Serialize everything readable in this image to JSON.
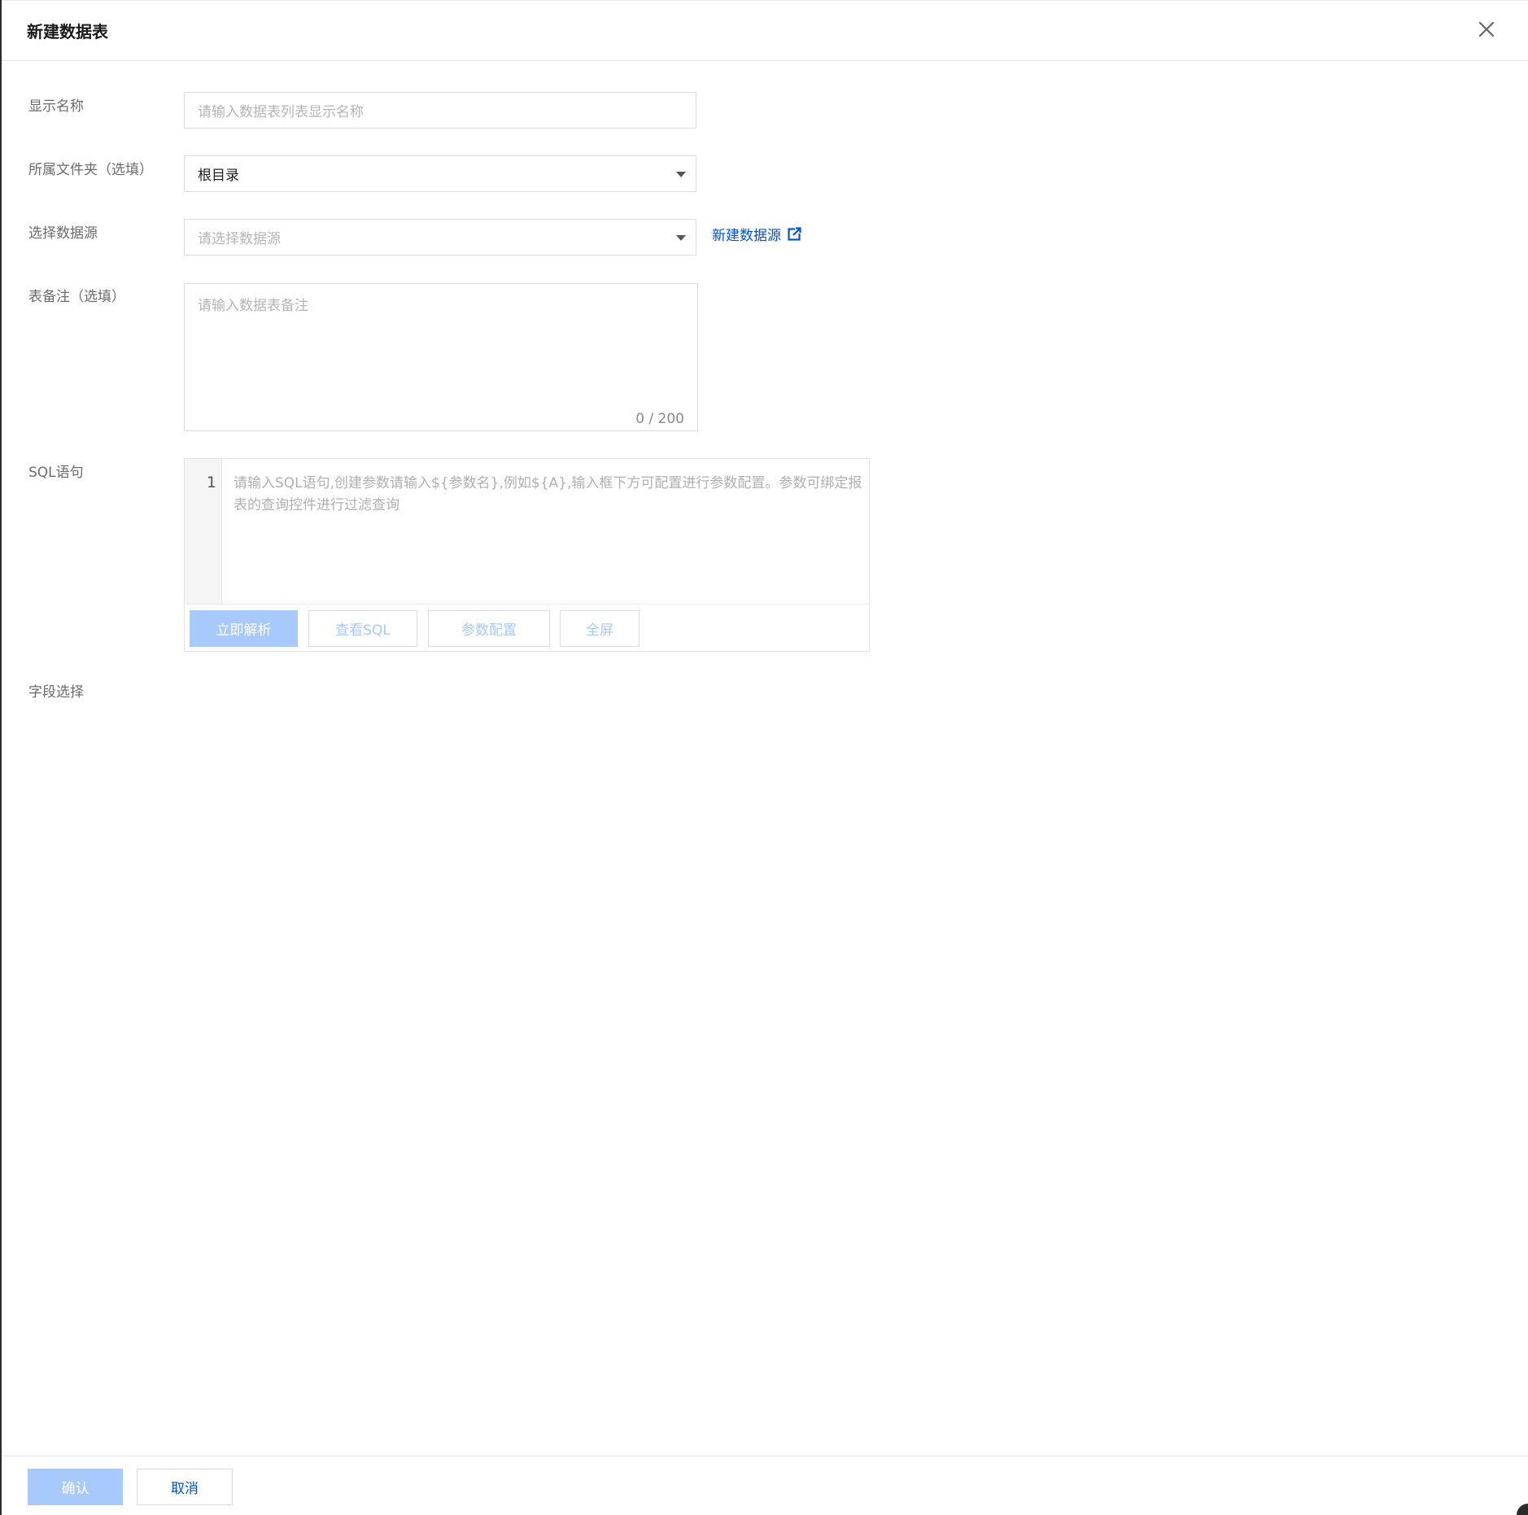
{
  "dialog": {
    "title": "新建数据表",
    "close_icon": "close-icon"
  },
  "form": {
    "display_name": {
      "label": "显示名称",
      "placeholder": "请输入数据表列表显示名称",
      "value": ""
    },
    "folder": {
      "label": "所属文件夹（选填）",
      "value": "根目录"
    },
    "datasource": {
      "label": "选择数据源",
      "placeholder": "请选择数据源",
      "new_link": "新建数据源",
      "link_icon": "external-link-icon"
    },
    "remark": {
      "label": "表备注（选填）",
      "placeholder": "请输入数据表备注",
      "counter": "0 / 200"
    },
    "sql": {
      "label": "SQL语句",
      "line_number": "1",
      "placeholder": "请输入SQL语句,创建参数请输入${参数名},例如${A},输入框下方可配置进行参数配置。参数可绑定报表的查询控件进行过滤查询",
      "buttons": {
        "parse": "立即解析",
        "view_sql": "查看SQL",
        "params": "参数配置",
        "fullscreen": "全屏"
      }
    },
    "fields": {
      "label": "字段选择"
    }
  },
  "footer": {
    "confirm": "确认",
    "cancel": "取消"
  },
  "colors": {
    "primary": "#0052d9",
    "primary_disabled": "#a8c9fb",
    "border": "#dcdcdc",
    "label": "#6b6b6b",
    "placeholder": "#b5b5b5"
  }
}
